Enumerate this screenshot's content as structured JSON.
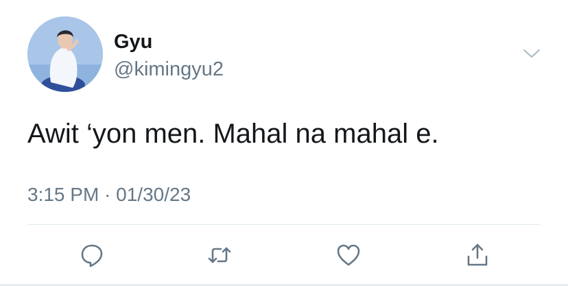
{
  "tweet": {
    "author": {
      "display_name": "Gyu",
      "handle": "@kimingyu2",
      "avatar_icon": "profile-photo"
    },
    "text": "Awit ‘yon men. Mahal na mahal e.",
    "timestamp": "3:15 PM · 01/30/23",
    "more_icon": "chevron-down-icon"
  },
  "actions": [
    {
      "name": "reply",
      "icon": "speech-bubble-icon"
    },
    {
      "name": "retweet",
      "icon": "retweet-arrows-icon"
    },
    {
      "name": "like",
      "icon": "heart-icon"
    },
    {
      "name": "share",
      "icon": "share-upload-icon"
    }
  ],
  "colors": {
    "text_primary": "#14171a",
    "text_secondary": "#657786",
    "icon": "#657786",
    "divider": "#e1e8ed"
  }
}
